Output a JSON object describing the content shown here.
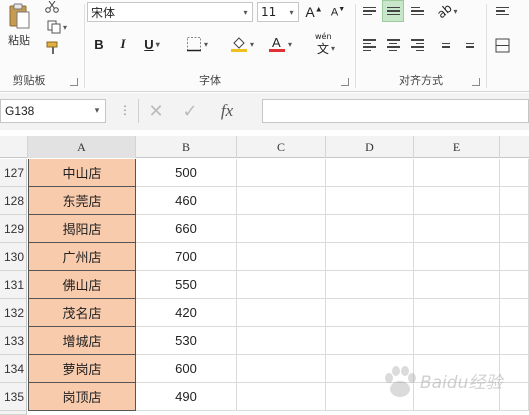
{
  "ribbon": {
    "clipboard": {
      "paste_label": "粘贴",
      "group_label": "剪贴板"
    },
    "font": {
      "font_name": "宋体",
      "font_size": "11",
      "bold": "B",
      "italic": "I",
      "underline": "U",
      "phonetic": "wén",
      "group_label": "字体",
      "font_color": "#e03030",
      "fill_color": "#f0c020"
    },
    "alignment": {
      "group_label": "对齐方式"
    }
  },
  "formula_bar": {
    "name_box": "G138",
    "cancel": "✕",
    "enter": "✓",
    "fx": "fx",
    "formula": ""
  },
  "grid": {
    "columns": [
      "A",
      "B",
      "C",
      "D",
      "E"
    ],
    "rows": [
      {
        "num": "127",
        "a": "中山店",
        "b": "500"
      },
      {
        "num": "128",
        "a": "东莞店",
        "b": "460"
      },
      {
        "num": "129",
        "a": "揭阳店",
        "b": "660"
      },
      {
        "num": "130",
        "a": "广州店",
        "b": "700"
      },
      {
        "num": "131",
        "a": "佛山店",
        "b": "550"
      },
      {
        "num": "132",
        "a": "茂名店",
        "b": "420"
      },
      {
        "num": "133",
        "a": "增城店",
        "b": "530"
      },
      {
        "num": "134",
        "a": "萝岗店",
        "b": "600"
      },
      {
        "num": "135",
        "a": "岗顶店",
        "b": "490"
      }
    ],
    "highlight_color": "#f8cbad"
  },
  "watermark": "Baidu经验"
}
